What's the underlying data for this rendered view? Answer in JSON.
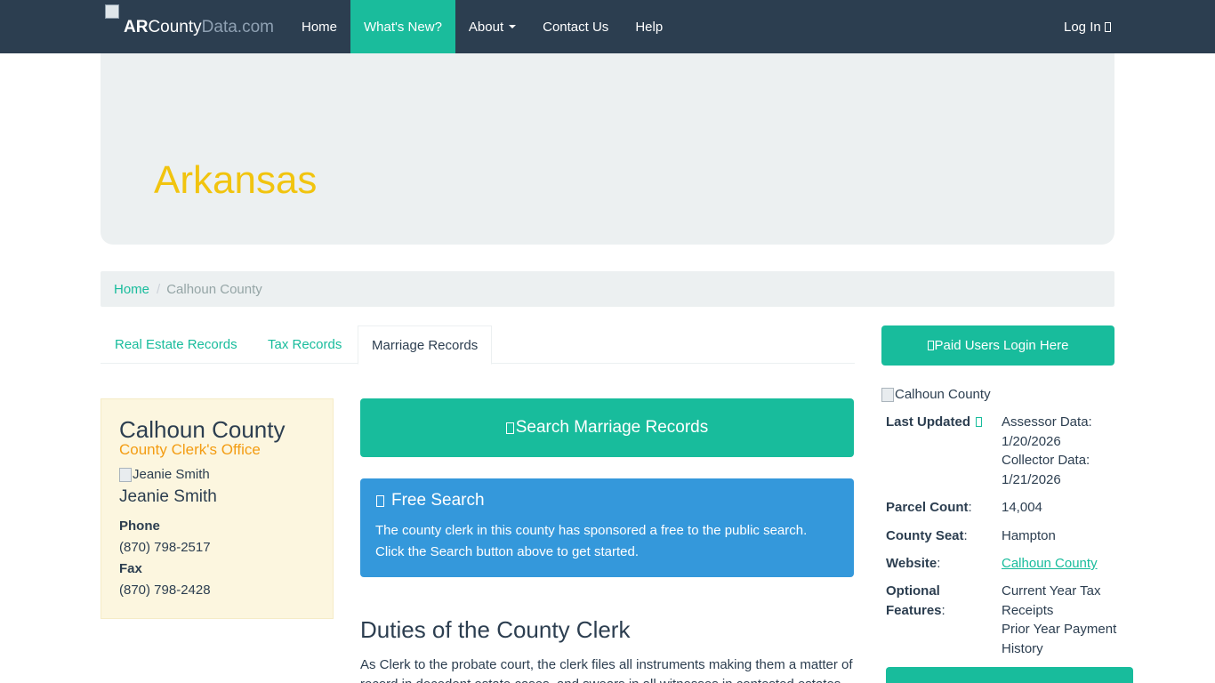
{
  "navbar": {
    "brand": {
      "part1": "AR",
      "part2": "County",
      "part3": "Data",
      "part4": ".com"
    },
    "items": [
      {
        "label": "Home"
      },
      {
        "label": "What's New?"
      },
      {
        "label": "About"
      },
      {
        "label": "Contact Us"
      },
      {
        "label": "Help"
      }
    ],
    "login_label": "Log In"
  },
  "jumbotron": {
    "title": "Arkansas"
  },
  "breadcrumb": {
    "home": "Home",
    "separator": "/",
    "current": "Calhoun County"
  },
  "tabs": [
    {
      "label": "Real Estate Records"
    },
    {
      "label": "Tax Records"
    },
    {
      "label": "Marriage Records"
    }
  ],
  "clerk": {
    "county": "Calhoun County",
    "office": "County Clerk's Office",
    "photo_alt": "Jeanie Smith",
    "name": "Jeanie Smith",
    "phone_label": "Phone",
    "phone": "(870) 798-2517",
    "fax_label": "Fax",
    "fax": "(870) 798-2428"
  },
  "search_button": {
    "label": "Search Marriage Records"
  },
  "free_search": {
    "title": "Free Search",
    "line1": "The county clerk in this county has sponsored a free to the public search.",
    "line2": "Click the Search button above to get started."
  },
  "duties": {
    "title": "Duties of the County Clerk",
    "text": "As Clerk to the probate court, the clerk files all instruments making them a matter of record in decedent estate cases, and swears in all witnesses in contested estates"
  },
  "sidebar": {
    "paid_login": "Paid Users Login Here",
    "county_img_alt": "Calhoun County",
    "last_updated_label": "Last Updated",
    "assessor_data_1": "Assessor Data:",
    "assessor_data_2": "1/20/2026",
    "collector_data_1": "Collector Data:",
    "collector_data_2": "1/21/2026",
    "parcel_count_label": "Parcel Count",
    "parcel_count": "14,004",
    "county_seat_label": "County Seat",
    "county_seat": "Hampton",
    "website_label": "Website",
    "website": "Calhoun County",
    "optional_label_1": "Optional",
    "optional_label_2": "Features",
    "colon": ":",
    "feature_1a": "Current Year Tax",
    "feature_1b": "Receipts",
    "feature_2a": "Prior Year Payment",
    "feature_2b": "History"
  },
  "colors": {
    "navbar": "#2c3e50",
    "accent": "#18bc9c",
    "jumbotron": "#ecf0f1",
    "title_yellow": "#f1c40f",
    "office_orange": "#f39c12",
    "info_blue": "#3498db",
    "clerk_card": "#fcf6df"
  }
}
